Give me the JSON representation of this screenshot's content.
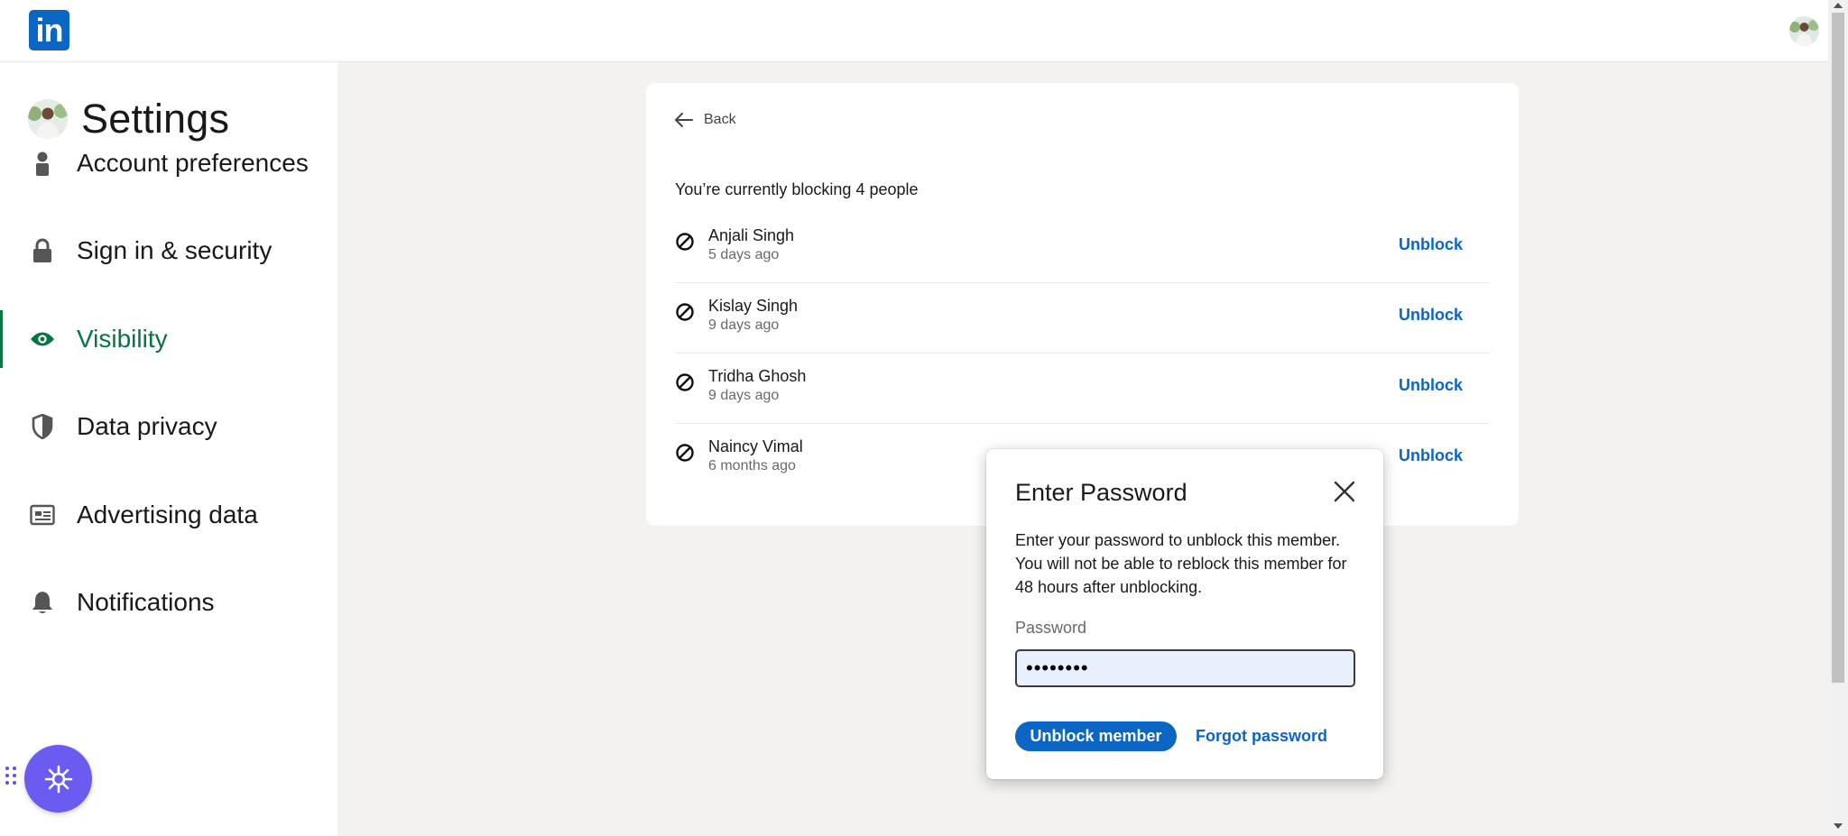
{
  "header": {
    "logo_text": "in",
    "logo_color": "#0a66c2"
  },
  "sidebar": {
    "title": "Settings",
    "items": [
      {
        "label": "Account preferences",
        "icon": "person-icon"
      },
      {
        "label": "Sign in & security",
        "icon": "lock-icon"
      },
      {
        "label": "Visibility",
        "icon": "eye-icon",
        "active": true
      },
      {
        "label": "Data privacy",
        "icon": "shield-icon"
      },
      {
        "label": "Advertising data",
        "icon": "ad-icon"
      },
      {
        "label": "Notifications",
        "icon": "bell-icon"
      }
    ],
    "active_color": "#057642"
  },
  "main": {
    "back_label": "Back",
    "summary": "You’re currently blocking 4 people",
    "blocked": [
      {
        "name": "Anjali Singh",
        "time": "5 days ago",
        "action": "Unblock"
      },
      {
        "name": "Kislay Singh",
        "time": "9 days ago",
        "action": "Unblock"
      },
      {
        "name": "Tridha Ghosh",
        "time": "9 days ago",
        "action": "Unblock"
      },
      {
        "name": "Naincy Vimal",
        "time": "6 months ago",
        "action": "Unblock"
      }
    ],
    "link_color": "#0a66c2"
  },
  "modal": {
    "title": "Enter Password",
    "description": "Enter your password to unblock this member. You will not be able to reblock this member for 48 hours after unblocking.",
    "password_label": "Password",
    "password_value": "••••••••",
    "primary_button": "Unblock member",
    "secondary_link": "Forgot password"
  }
}
